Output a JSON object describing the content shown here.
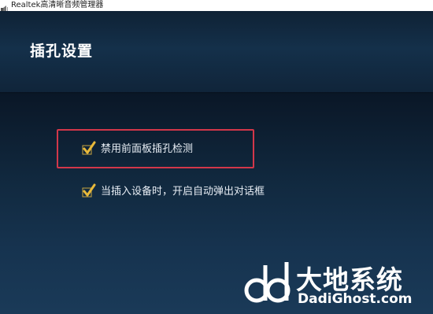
{
  "window": {
    "title": "Realtek高清晰音频管理器"
  },
  "header": {
    "title": "插孔设置"
  },
  "options": [
    {
      "label": "禁用前面板插孔检测",
      "checked": true,
      "highlighted": true
    },
    {
      "label": "当插入设备时，开启自动弹出对话框",
      "checked": true,
      "highlighted": false
    }
  ],
  "icons": {
    "app": "speaker-icon",
    "check": "checkmark-icon"
  },
  "colors": {
    "check": "#e8b93a",
    "highlight_border": "#d2374a",
    "text": "#e8eef5"
  },
  "watermark": {
    "cn": "大地系统",
    "en": "DadiGhost.com"
  }
}
